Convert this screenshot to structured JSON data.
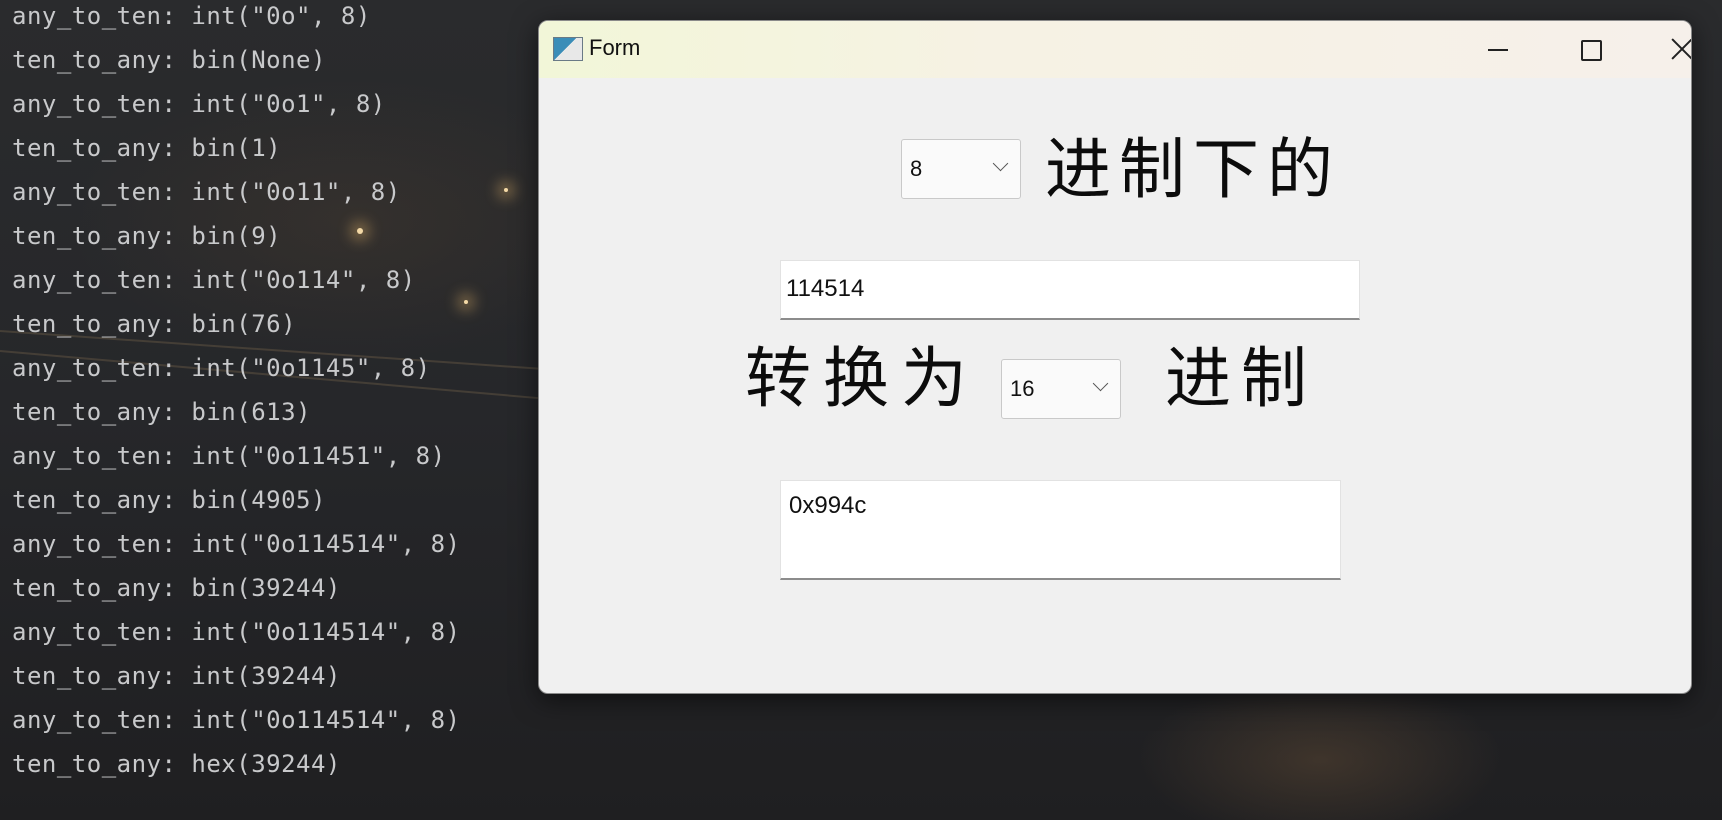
{
  "terminal": {
    "lines": [
      "any_to_ten: int(\"0o\", 8)",
      "ten_to_any: bin(None)",
      "any_to_ten: int(\"0o1\", 8)",
      "ten_to_any: bin(1)",
      "any_to_ten: int(\"0o11\", 8)",
      "ten_to_any: bin(9)",
      "any_to_ten: int(\"0o114\", 8)",
      "ten_to_any: bin(76)",
      "any_to_ten: int(\"0o1145\", 8)",
      "ten_to_any: bin(613)",
      "any_to_ten: int(\"0o11451\", 8)",
      "ten_to_any: bin(4905)",
      "any_to_ten: int(\"0o114514\", 8)",
      "ten_to_any: bin(39244)",
      "any_to_ten: int(\"0o114514\", 8)",
      "ten_to_any: int(39244)",
      "any_to_ten: int(\"0o114514\", 8)",
      "ten_to_any: hex(39244)"
    ]
  },
  "window": {
    "title": "Form",
    "app_icon": "form-app-icon",
    "controls": {
      "minimize": "minimize-icon",
      "maximize": "maximize-icon",
      "close": "close-icon"
    }
  },
  "form": {
    "from_base": "8",
    "from_suffix_label": "进制下的",
    "input_value": "114514",
    "convert_label": "转换为",
    "to_base": "16",
    "to_suffix_label": "进制",
    "output_value": "0x994c"
  }
}
